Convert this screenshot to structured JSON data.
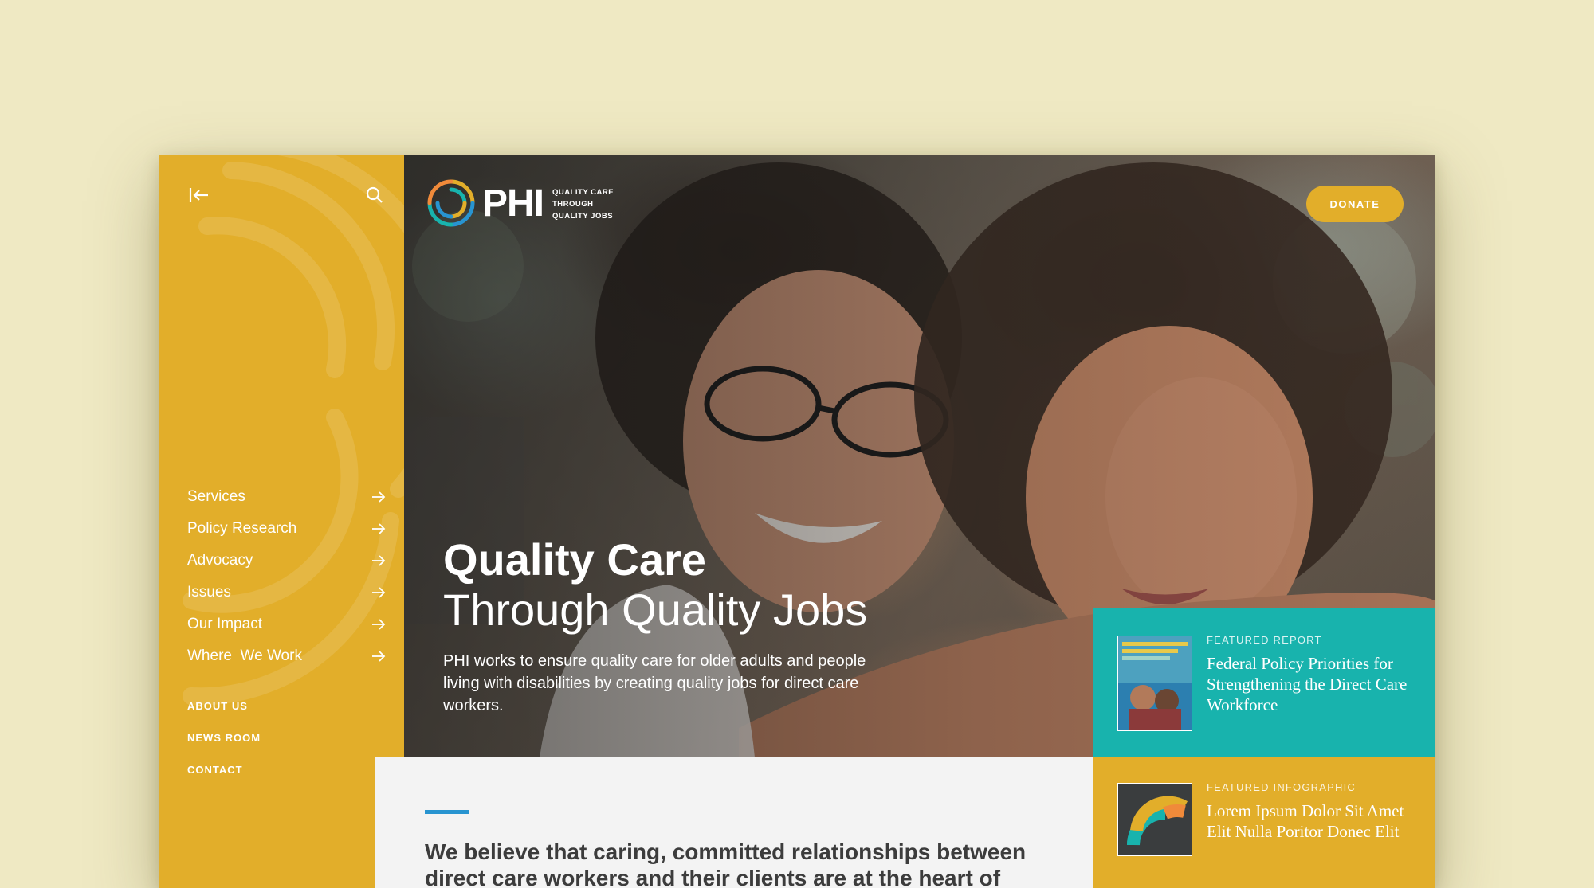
{
  "sidebar": {
    "nav_items": [
      {
        "label": "Services"
      },
      {
        "label": "Policy Research"
      },
      {
        "label": "Advocacy"
      },
      {
        "label": "Issues"
      },
      {
        "label": "Our Impact"
      },
      {
        "label": "Where  We Work"
      }
    ],
    "secondary_items": [
      {
        "label": "ABOUT US"
      },
      {
        "label": "NEWS ROOM"
      },
      {
        "label": "CONTACT"
      }
    ]
  },
  "header": {
    "logo_text": "PHI",
    "logo_tagline": [
      "QUALITY CARE",
      "THROUGH",
      "QUALITY JOBS"
    ],
    "donate_label": "DONATE"
  },
  "hero": {
    "title_bold": "Quality Care",
    "title_light": "Through Quality Jobs",
    "description": "PHI works to ensure quality care for older adults and people living with disabilities by creating quality jobs for direct care workers."
  },
  "content": {
    "statement": "We believe that caring, committed relationships between direct care workers and their clients are at the heart of"
  },
  "features": {
    "report": {
      "label": "FEATURED REPORT",
      "title": "Federal Policy Priorities for Strengthening the Direct Care Workforce"
    },
    "infographic": {
      "label": "FEATURED INFOGRAPHIC",
      "title": "Lorem Ipsum Dolor Sit Amet Elit Nulla Poritor Donec Elit"
    }
  },
  "colors": {
    "page_background": "#efe9c3",
    "brand_yellow": "#e2ae2a",
    "brand_teal": "#18b3ad",
    "accent_blue": "#2894d0"
  },
  "icons": {
    "collapse": "collapse-arrow-icon",
    "search": "search-icon",
    "nav_arrow": "arrow-right-icon"
  }
}
